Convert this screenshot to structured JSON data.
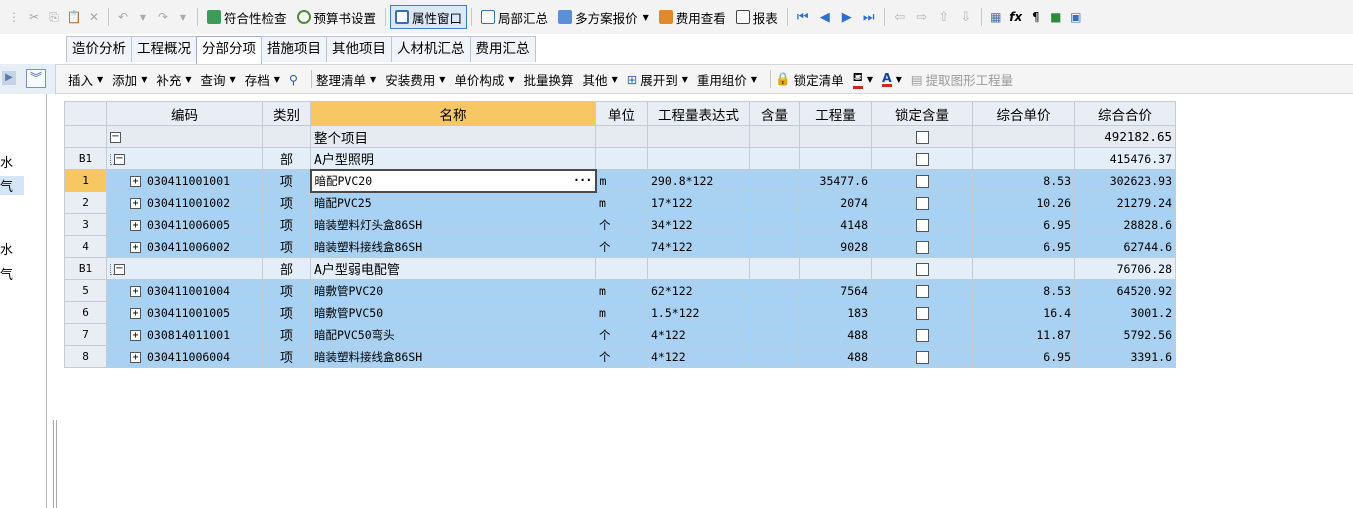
{
  "toolbar": {
    "compliance_check": "符合性检查",
    "budget_settings": "预算书设置",
    "property_window": "属性窗口",
    "partial_summary": "局部汇总",
    "multi_plan_quote": "多方案报价",
    "fee_view": "费用查看",
    "report": "报表"
  },
  "tabs": [
    {
      "label": "造价分析"
    },
    {
      "label": "工程概况"
    },
    {
      "label": "分部分项"
    },
    {
      "label": "措施项目"
    },
    {
      "label": "其他项目"
    },
    {
      "label": "人材机汇总"
    },
    {
      "label": "费用汇总"
    }
  ],
  "left_pane": [
    "水",
    "气",
    "水",
    "气"
  ],
  "toolbar2": {
    "insert": "插入",
    "add": "添加",
    "supplement": "补充",
    "query": "查询",
    "archive": "存档",
    "organize": "整理清单",
    "install_fee": "安装费用",
    "unit_price_comp": "单价构成",
    "batch_convert": "批量换算",
    "other": "其他",
    "expand_to": "展开到",
    "reuse_group": "重用组价",
    "lock_list": "锁定清单",
    "extract_qty": "提取图形工程量"
  },
  "grid": {
    "headers": {
      "code": "编码",
      "type": "类别",
      "name": "名称",
      "unit": "单位",
      "expr": "工程量表达式",
      "content": "含量",
      "qty": "工程量",
      "lock": "锁定含量",
      "unit_price": "综合单价",
      "total_price": "综合合价"
    },
    "total_row": {
      "name": "整个项目",
      "price": "492182.65"
    },
    "sections": [
      {
        "num": "B1",
        "type": "部",
        "name": "A户型照明",
        "price": "415476.37",
        "rows": [
          {
            "num": "1",
            "code": "030411001001",
            "type": "项",
            "name": "暗配PVC20",
            "unit": "m",
            "expr": "290.8*122",
            "qty": "35477.6",
            "unit_price": "8.53",
            "total": "302623.93"
          },
          {
            "num": "2",
            "code": "030411001002",
            "type": "项",
            "name": "暗配PVC25",
            "unit": "m",
            "expr": "17*122",
            "qty": "2074",
            "unit_price": "10.26",
            "total": "21279.24"
          },
          {
            "num": "3",
            "code": "030411006005",
            "type": "项",
            "name": "暗装塑料灯头盒86SH",
            "unit": "个",
            "expr": "34*122",
            "qty": "4148",
            "unit_price": "6.95",
            "total": "28828.6"
          },
          {
            "num": "4",
            "code": "030411006002",
            "type": "项",
            "name": "暗装塑料接线盒86SH",
            "unit": "个",
            "expr": "74*122",
            "qty": "9028",
            "unit_price": "6.95",
            "total": "62744.6"
          }
        ]
      },
      {
        "num": "B1",
        "type": "部",
        "name": "A户型弱电配管",
        "price": "76706.28",
        "rows": [
          {
            "num": "5",
            "code": "030411001004",
            "type": "项",
            "name": "暗敷管PVC20",
            "unit": "m",
            "expr": "62*122",
            "qty": "7564",
            "unit_price": "8.53",
            "total": "64520.92"
          },
          {
            "num": "6",
            "code": "030411001005",
            "type": "项",
            "name": "暗敷管PVC50",
            "unit": "m",
            "expr": "1.5*122",
            "qty": "183",
            "unit_price": "16.4",
            "total": "3001.2"
          },
          {
            "num": "7",
            "code": "030814011001",
            "type": "项",
            "name": "暗配PVC50弯头",
            "unit": "个",
            "expr": "4*122",
            "qty": "488",
            "unit_price": "11.87",
            "total": "5792.56"
          },
          {
            "num": "8",
            "code": "030411006004",
            "type": "项",
            "name": "暗装塑料接线盒86SH",
            "unit": "个",
            "expr": "4*122",
            "qty": "488",
            "unit_price": "6.95",
            "total": "3391.6"
          }
        ]
      }
    ]
  }
}
